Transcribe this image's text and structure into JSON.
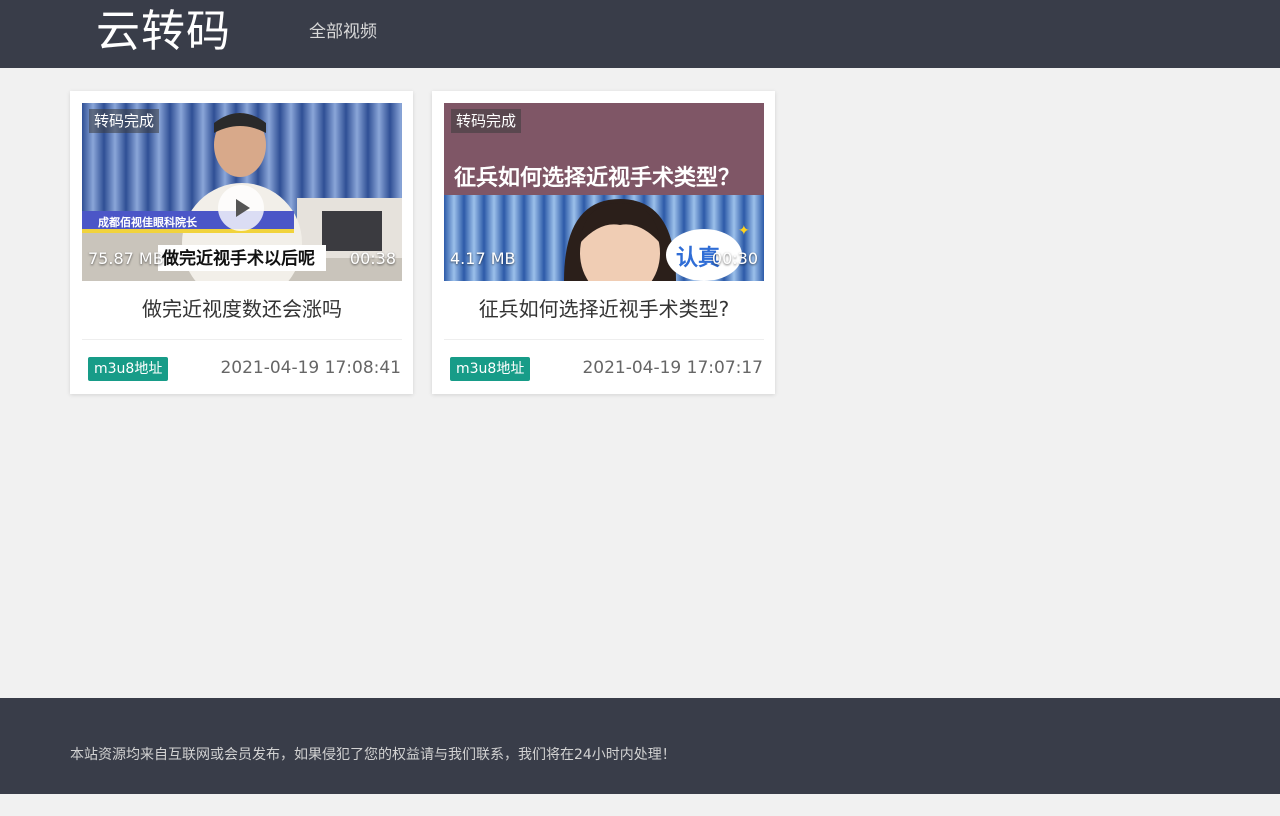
{
  "header": {
    "logo": "云转码",
    "nav": [
      {
        "label": "全部视频"
      }
    ]
  },
  "videos": [
    {
      "status": "转码完成",
      "size": "75.87 MB",
      "duration": "00:38",
      "title": "做完近视度数还会涨吗",
      "tag": "m3u8地址",
      "date": "2021-04-19 17:08:41",
      "thumb_caption": "做完近视手术以后呢",
      "thumb_sublabel": "成都佰视佳眼科院长"
    },
    {
      "status": "转码完成",
      "size": "4.17 MB",
      "duration": "00:30",
      "title": "征兵如何选择近视手术类型?",
      "tag": "m3u8地址",
      "date": "2021-04-19 17:07:17",
      "thumb_banner": "征兵如何选择近视手术类型？",
      "thumb_sticker": "认真"
    }
  ],
  "footer": {
    "text": "本站资源均来自互联网或会员发布，如果侵犯了您的权益请与我们联系，我们将在24小时内处理！"
  },
  "colors": {
    "header_bg": "#393d49",
    "page_bg": "#f1f1f1",
    "tag_green": "#179c88"
  }
}
